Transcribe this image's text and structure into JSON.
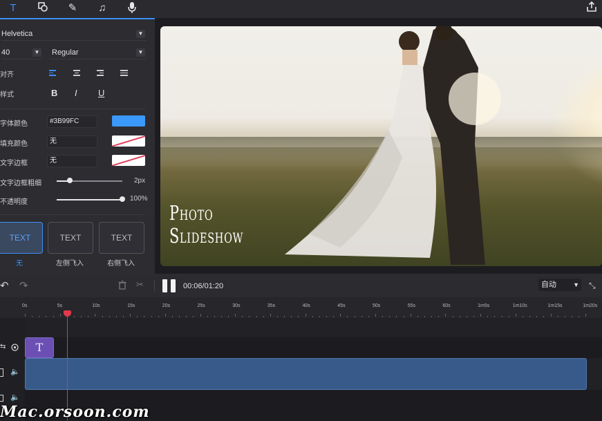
{
  "colors": {
    "accent": "#3B99FC",
    "selected_blue": "#3b8ff7",
    "playhead": "#e0394a",
    "text_clip": "#6b4fb3",
    "video_clip": "#375a8a"
  },
  "toolbar": {
    "tabs": [
      {
        "icon": "text-icon",
        "glyph": "T"
      },
      {
        "icon": "shapes-icon",
        "glyph": "◰"
      },
      {
        "icon": "pen-icon",
        "glyph": "✎"
      },
      {
        "icon": "music-icon",
        "glyph": "♫"
      },
      {
        "icon": "microphone-icon",
        "glyph": "🎙"
      }
    ],
    "export_icon": "share-icon"
  },
  "text_panel": {
    "font_family": "Helvetica",
    "font_size": "40",
    "font_weight": "Regular",
    "align_label": "对齐",
    "style_label": "样式",
    "style_buttons": [
      "B",
      "I",
      "U"
    ],
    "font_color_label": "字体颜色",
    "font_color_value": "#3B99FC",
    "fill_color_label": "填充颜色",
    "fill_color_value": "无",
    "border_label": "文字边框",
    "border_value": "无",
    "border_width_label": "文字边框粗细",
    "border_width_value": "2px",
    "border_width_fraction": 0.2,
    "opacity_label": "不透明度",
    "opacity_value": "100%",
    "opacity_fraction": 1.0,
    "animations": [
      {
        "preview": "TEXT",
        "label": "无",
        "selected": true
      },
      {
        "preview": "TEXT",
        "label": "左侧飞入",
        "selected": false
      },
      {
        "preview": "TEXT",
        "label": "右侧飞入",
        "selected": false
      }
    ]
  },
  "preview": {
    "overlay_line1": "Photo",
    "overlay_line2": "Slideshow"
  },
  "controls": {
    "time": "00:06/01:20",
    "zoom_select": "自动"
  },
  "timeline": {
    "ticks": [
      "0s",
      "5s",
      "10s",
      "15s",
      "20s",
      "25s",
      "30s",
      "35s",
      "40s",
      "45s",
      "50s",
      "55s",
      "60s",
      "1m5s",
      "1m10s",
      "1m15s",
      "1m20s"
    ],
    "playhead_seconds": 6,
    "text_clip_glyph": "T"
  },
  "watermark": "Mac.orsoon.com"
}
